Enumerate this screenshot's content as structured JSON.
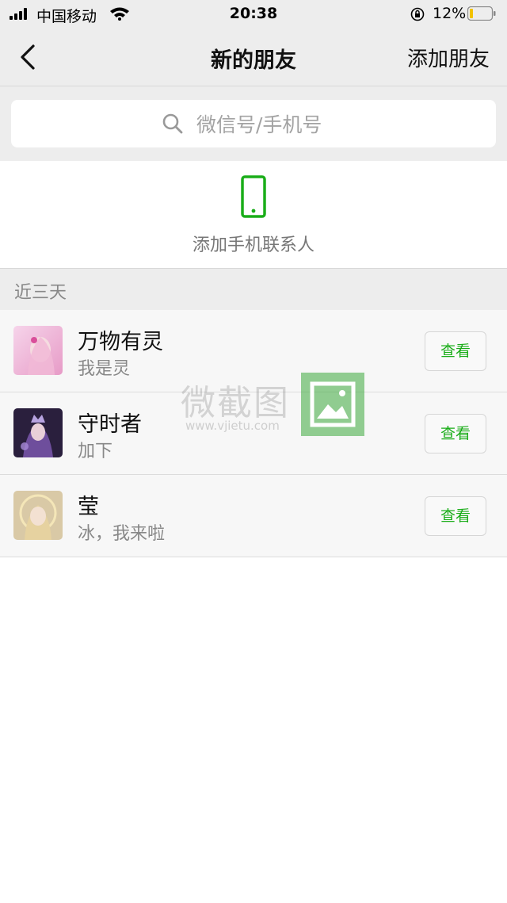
{
  "status_bar": {
    "carrier": "中国移动",
    "time": "20:38",
    "battery_percent": "12%"
  },
  "nav": {
    "title": "新的朋友",
    "add_friend_label": "添加朋友"
  },
  "search": {
    "placeholder": "微信号/手机号"
  },
  "add_contacts": {
    "label": "添加手机联系人",
    "icon": "phone-icon",
    "icon_color": "#1aad19"
  },
  "section": {
    "title": "近三天"
  },
  "friends": [
    {
      "name": "万物有灵",
      "message": "我是灵",
      "action": "查看"
    },
    {
      "name": "守时者",
      "message": "加下",
      "action": "查看"
    },
    {
      "name": "莹",
      "message": "冰，我来啦",
      "action": "查看"
    }
  ],
  "watermark": {
    "text": "微截图",
    "url": "www.vjietu.com"
  },
  "colors": {
    "accent": "#1aad19",
    "background": "#ededed"
  }
}
